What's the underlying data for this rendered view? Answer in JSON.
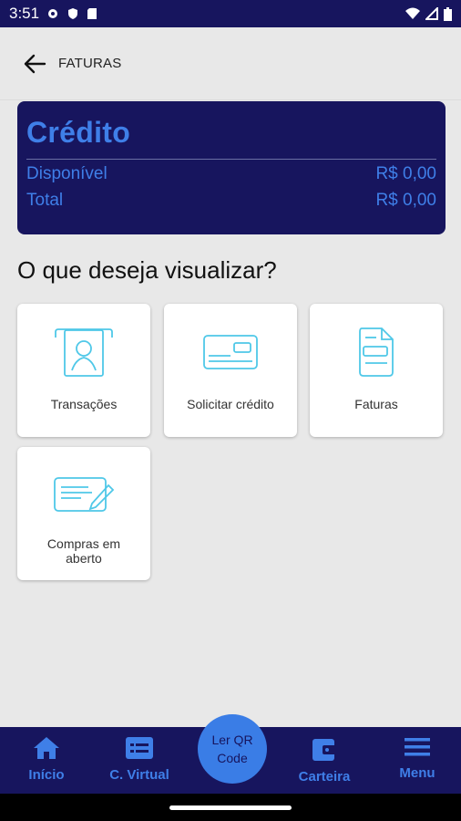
{
  "status_bar": {
    "time": "3:51"
  },
  "app_bar": {
    "title": "FATURAS"
  },
  "credit": {
    "title": "Crédito",
    "rows": [
      {
        "label": "Disponível",
        "value": "R$ 0,00"
      },
      {
        "label": "Total",
        "value": "R$ 0,00"
      }
    ]
  },
  "section": {
    "title": "O que deseja visualizar?"
  },
  "tiles": [
    {
      "label": "Transações",
      "icon": "transactions-icon"
    },
    {
      "label": "Solicitar crédito",
      "icon": "credit-card-icon"
    },
    {
      "label": "Faturas",
      "icon": "invoice-icon"
    },
    {
      "label": "Compras em aberto",
      "icon": "open-purchases-icon"
    }
  ],
  "bottom_nav": {
    "items": [
      {
        "label": "Início",
        "icon": "home-icon"
      },
      {
        "label": "C. Virtual",
        "icon": "virtual-card-icon"
      },
      {
        "label": "Carteira",
        "icon": "wallet-icon"
      },
      {
        "label": "Menu",
        "icon": "menu-icon"
      }
    ],
    "qr_label": "Ler QR Code"
  },
  "colors": {
    "navy": "#17155e",
    "accent": "#3f7fe8",
    "icon_cyan": "#4fc8e8"
  }
}
